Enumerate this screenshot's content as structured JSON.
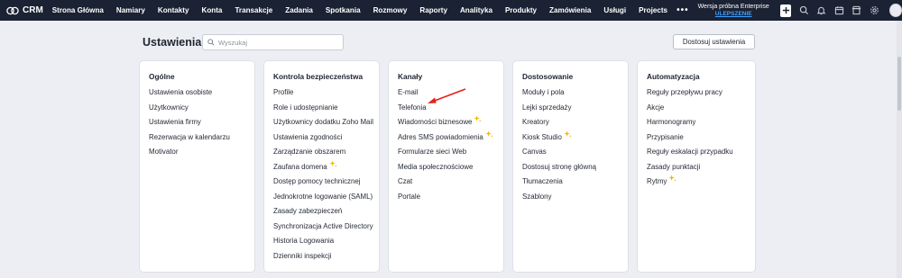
{
  "topbar": {
    "brand": "CRM",
    "nav": [
      "Strona Główna",
      "Namiary",
      "Kontakty",
      "Konta",
      "Transakcje",
      "Zadania",
      "Spotkania",
      "Rozmowy",
      "Raporty",
      "Analityka",
      "Produkty",
      "Zamówienia",
      "Usługi",
      "Projects"
    ],
    "more": "•••",
    "trial_text": "Wersja próbna Enterprise",
    "upgrade_label": "ULEPSZENIE",
    "icons": [
      "plus-icon",
      "search-icon",
      "bell-icon",
      "calendar-icon",
      "marketplace-icon",
      "gear-icon",
      "avatar"
    ]
  },
  "header": {
    "title": "Ustawienia",
    "search_placeholder": "Wyszukaj",
    "customize_label": "Dostosuj ustawienia"
  },
  "cards": [
    {
      "title": "Ogólne",
      "items": [
        {
          "label": "Ustawienia osobiste"
        },
        {
          "label": "Użytkownicy"
        },
        {
          "label": "Ustawienia firmy"
        },
        {
          "label": "Rezerwacja w kalendarzu"
        },
        {
          "label": "Motivator"
        }
      ]
    },
    {
      "title": "Kontrola bezpieczeństwa",
      "items": [
        {
          "label": "Profile"
        },
        {
          "label": "Role i udostępnianie"
        },
        {
          "label": "Użytkownicy dodatku Zoho Mail"
        },
        {
          "label": "Ustawienia zgodności"
        },
        {
          "label": "Zarządzanie obszarem"
        },
        {
          "label": "Zaufana domena",
          "sparkle": true
        },
        {
          "label": "Dostęp pomocy technicznej"
        },
        {
          "label": "Jednokrotne logowanie (SAML)"
        },
        {
          "label": "Zasady zabezpieczeń"
        },
        {
          "label": "Synchronizacja Active Directory"
        },
        {
          "label": "Historia Logowania"
        },
        {
          "label": "Dzienniki inspekcji"
        }
      ]
    },
    {
      "title": "Kanały",
      "items": [
        {
          "label": "E-mail"
        },
        {
          "label": "Telefonia"
        },
        {
          "label": "Wiadomości biznesowe",
          "sparkle": true
        },
        {
          "label": "Adres SMS powiadomienia",
          "sparkle": true
        },
        {
          "label": "Formularze sieci Web"
        },
        {
          "label": "Media społecznościowe"
        },
        {
          "label": "Czat"
        },
        {
          "label": "Portale"
        }
      ]
    },
    {
      "title": "Dostosowanie",
      "items": [
        {
          "label": "Moduły i pola"
        },
        {
          "label": "Lejki sprzedaży"
        },
        {
          "label": "Kreatory"
        },
        {
          "label": "Kiosk Studio",
          "sparkle": true
        },
        {
          "label": "Canvas"
        },
        {
          "label": "Dostosuj stronę główną"
        },
        {
          "label": "Tłumaczenia"
        },
        {
          "label": "Szablony"
        }
      ]
    },
    {
      "title": "Automatyzacja",
      "items": [
        {
          "label": "Reguły przepływu pracy"
        },
        {
          "label": "Akcje"
        },
        {
          "label": "Harmonogramy"
        },
        {
          "label": "Przypisanie"
        },
        {
          "label": "Reguły eskalacji przypadku"
        },
        {
          "label": "Zasady punktacji"
        },
        {
          "label": "Rytmy",
          "sparkle": true
        }
      ]
    }
  ],
  "colors": {
    "topbar": "#1b2233",
    "background": "#eceef3",
    "annotation_arrow": "#e2231a",
    "sparkle": "#f5b800",
    "upgrade": "#3fa0ff"
  }
}
